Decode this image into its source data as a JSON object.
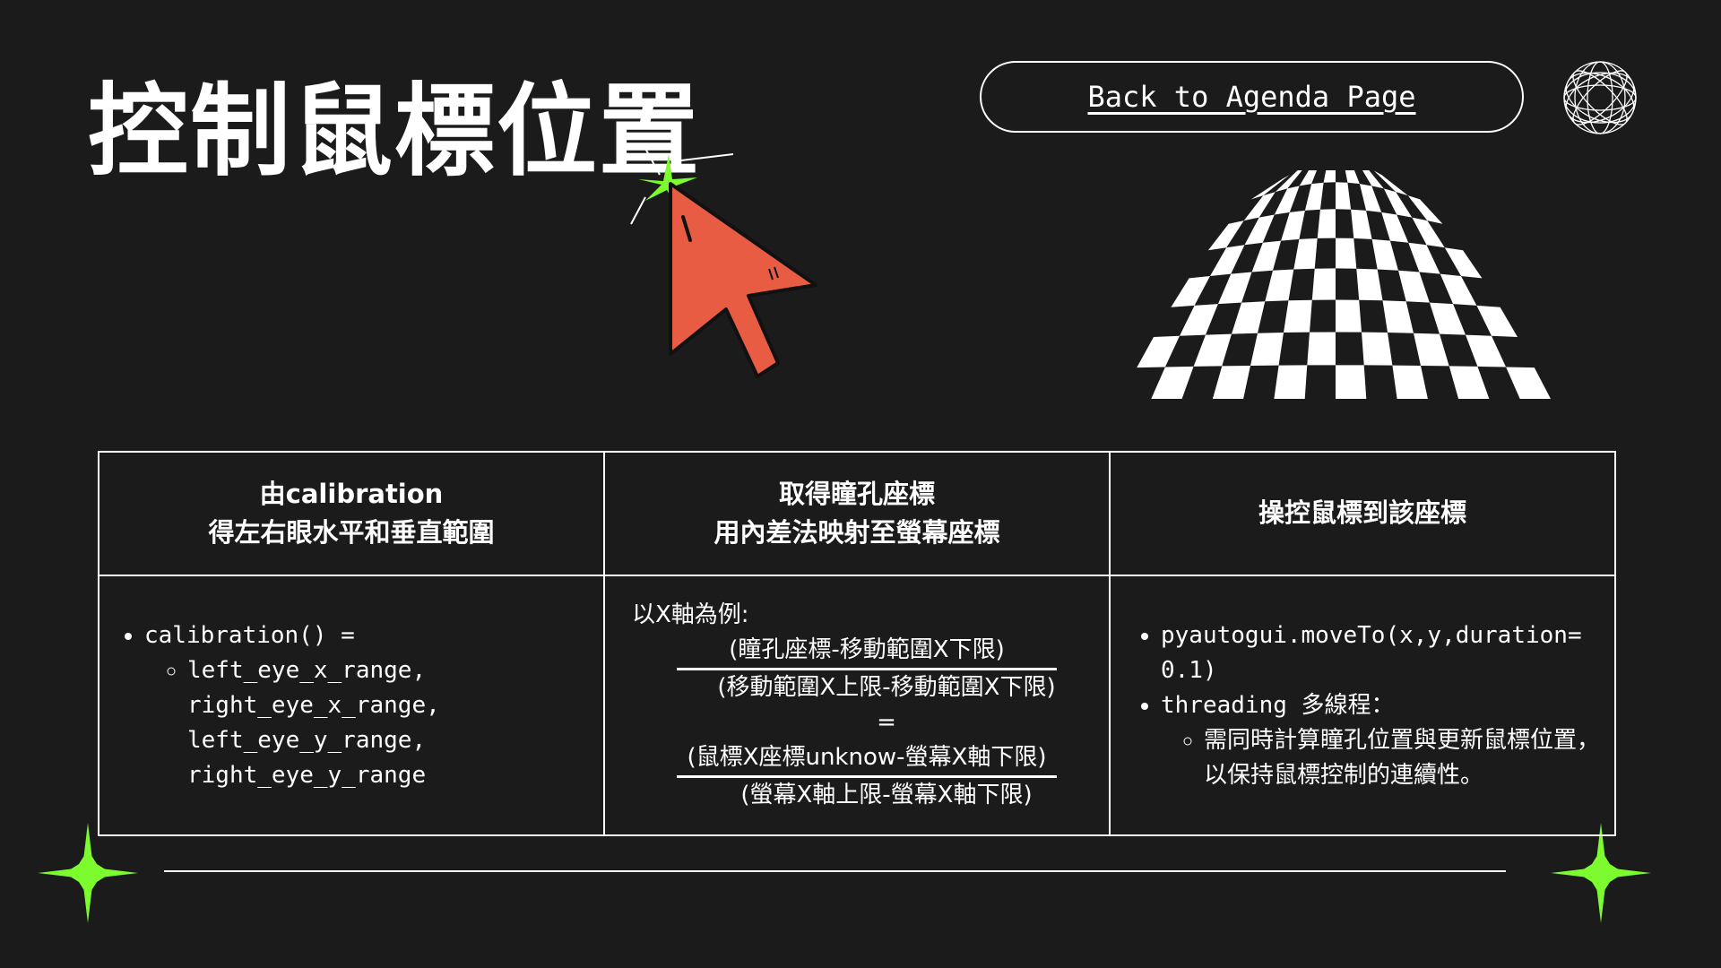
{
  "slide": {
    "title": "控制鼠標位置",
    "back_link_label": "Back to Agenda Page"
  },
  "colors": {
    "background": "#1b1b1b",
    "text": "#ffffff",
    "accent_green": "#7cfc2e",
    "cursor_red": "#e85c44"
  },
  "icons": [
    "globe-icon",
    "checkerboard-graphic",
    "cursor-arrow-icon",
    "sparkle-icon"
  ],
  "table": {
    "headers": [
      {
        "line1": "由calibration",
        "line2": "得左右眼水平和垂直範圍"
      },
      {
        "line1": "取得瞳孔座標",
        "line2": "用內差法映射至螢幕座標"
      },
      {
        "line1": "操控鼠標到該座標",
        "line2": ""
      }
    ],
    "col1": {
      "bullet": "calibration() =",
      "sub_lines": [
        "left_eye_x_range,",
        "right_eye_x_range,",
        "left_eye_y_range,",
        "right_eye_y_range"
      ]
    },
    "col2": {
      "lead": "以X軸為例:",
      "fraction1_num": "(瞳孔座標-移動範圍X下限)",
      "fraction1_den": "(移動範圍X上限-移動範圍X下限)",
      "equals": "=",
      "fraction2_num": "(鼠標X座標unknow-螢幕X軸下限)",
      "fraction2_den": "(螢幕X軸上限-螢幕X軸下限)"
    },
    "col3": {
      "bullet1": "pyautogui.moveTo(x,y,duration=0.1)",
      "bullet2": "threading 多線程：",
      "sub": "需同時計算瞳孔位置與更新鼠標位置，以保持鼠標控制的連續性。"
    }
  }
}
